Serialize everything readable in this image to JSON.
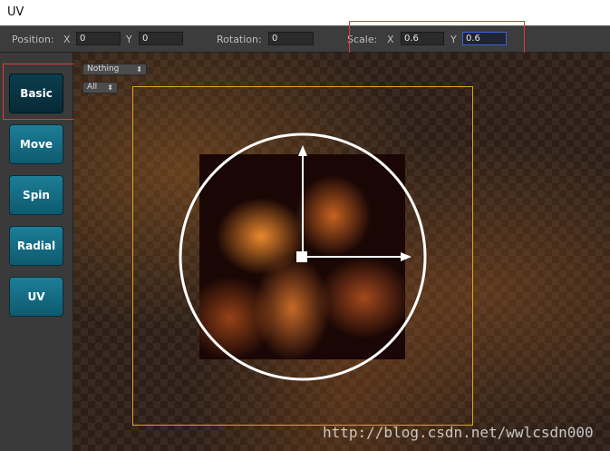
{
  "window": {
    "title": "UV"
  },
  "toolbar": {
    "position_label": "Position:",
    "position_x_label": "X",
    "position_x_value": "0",
    "position_y_label": "Y",
    "position_y_value": "0",
    "rotation_label": "Rotation:",
    "rotation_value": "0",
    "scale_label": "Scale:",
    "scale_x_label": "X",
    "scale_x_value": "0.6",
    "scale_y_label": "Y",
    "scale_y_value": "0.6"
  },
  "tools": [
    {
      "label": "Basic",
      "active": true
    },
    {
      "label": "Move",
      "active": false
    },
    {
      "label": "Spin",
      "active": false
    },
    {
      "label": "Radial",
      "active": false
    },
    {
      "label": "UV",
      "active": false
    }
  ],
  "viewport": {
    "dropdowns": {
      "filter": "Nothing",
      "channel": "All"
    },
    "frame_color": "#e0a21c",
    "highlight_color": "#e23a3a",
    "focus_color": "#3d63d6",
    "gizmo_icons": [
      "rotation-circle",
      "y-arrow",
      "x-arrow",
      "pivot-square"
    ]
  },
  "watermark": "http://blog.csdn.net/wwlcsdn000"
}
